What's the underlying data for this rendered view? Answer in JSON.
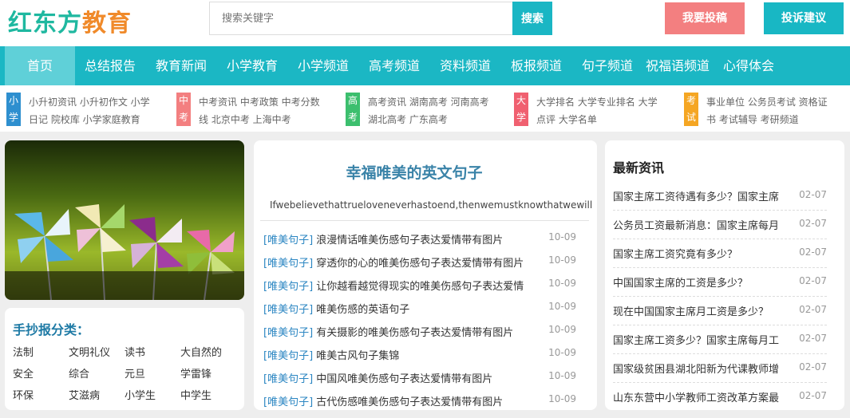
{
  "header": {
    "logo_text_1": "红东方",
    "logo_text_2": "教育",
    "search_placeholder": "搜索关键字",
    "search_button": "搜索",
    "submit_button": "我要投稿",
    "feedback_button": "投诉建议"
  },
  "nav": {
    "items": [
      "首页",
      "总结报告",
      "教育新闻",
      "小学教育",
      "小学频道",
      "高考频道",
      "资料频道",
      "板报频道",
      "句子频道",
      "祝福语频道",
      "心得体会"
    ]
  },
  "categories": [
    {
      "tag": "小学",
      "color": "#2e8fcf",
      "line1": "小升初资讯  小升初作文  小学",
      "line2": "日记  院校库  小学家庭教育"
    },
    {
      "tag": "中考",
      "color": "#f37f80",
      "line1": "中考资讯  中考政策  中考分数",
      "line2": "线  北京中考  上海中考"
    },
    {
      "tag": "高考",
      "color": "#3cbf6e",
      "line1": "高考资讯  湖南高考  河南高考",
      "line2": "湖北高考  广东高考"
    },
    {
      "tag": "大学",
      "color": "#f06070",
      "line1": "大学排名  大学专业排名  大学",
      "line2": "点评  大学名单"
    },
    {
      "tag": "考试",
      "color": "#f5a623",
      "line1": "事业单位  公务员考试  资格证",
      "line2": "书  考试辅导  考研频道"
    }
  ],
  "classify": {
    "title": "手抄报分类：",
    "items": [
      "法制",
      "文明礼仪",
      "读书",
      "大自然的",
      "安全",
      "综合",
      "元旦",
      "学雷锋",
      "环保",
      "艾滋病",
      "小学生",
      "中学生"
    ]
  },
  "middle": {
    "title": "幸福唯美的英文句子",
    "subtitle": "Ifwebelievethattrueloveneverhastoend,thenwemustknowthatwewilllove",
    "articles": [
      {
        "tag": "[唯美句子]",
        "title": "浪漫情话唯美伤感句子表达爱情带有图片",
        "date": "10-09"
      },
      {
        "tag": "[唯美句子]",
        "title": "穿透你的心的唯美伤感句子表达爱情带有图片",
        "date": "10-09"
      },
      {
        "tag": "[唯美句子]",
        "title": "让你越看越觉得现实的唯美伤感句子表达爱情",
        "date": "10-09"
      },
      {
        "tag": "[唯美句子]",
        "title": "唯美伤感的英语句子",
        "date": "10-09"
      },
      {
        "tag": "[唯美句子]",
        "title": "有关摄影的唯美伤感句子表达爱情带有图片",
        "date": "10-09"
      },
      {
        "tag": "[唯美句子]",
        "title": "唯美古风句子集锦",
        "date": "10-09"
      },
      {
        "tag": "[唯美句子]",
        "title": "中国风唯美伤感句子表达爱情带有图片",
        "date": "10-09"
      },
      {
        "tag": "[唯美句子]",
        "title": "古代伤感唯美伤感句子表达爱情带有图片",
        "date": "10-09"
      }
    ]
  },
  "news": {
    "title": "最新资讯",
    "items": [
      {
        "title": "国家主席工资待遇有多少？国家主席",
        "date": "02-07"
      },
      {
        "title": "公务员工资最新消息：国家主席每月",
        "date": "02-07"
      },
      {
        "title": "国家主席工资究竟有多少？",
        "date": "02-07"
      },
      {
        "title": "中国国家主席的工资是多少？",
        "date": "02-07"
      },
      {
        "title": "现在中国国家主席月工资是多少？",
        "date": "02-07"
      },
      {
        "title": "国家主席工资多少？国家主席每月工",
        "date": "02-07"
      },
      {
        "title": "国家级贫困县湖北阳新为代课教师增",
        "date": "02-07"
      },
      {
        "title": "山东东营中小学教师工资改革方案最",
        "date": "02-07"
      }
    ]
  }
}
